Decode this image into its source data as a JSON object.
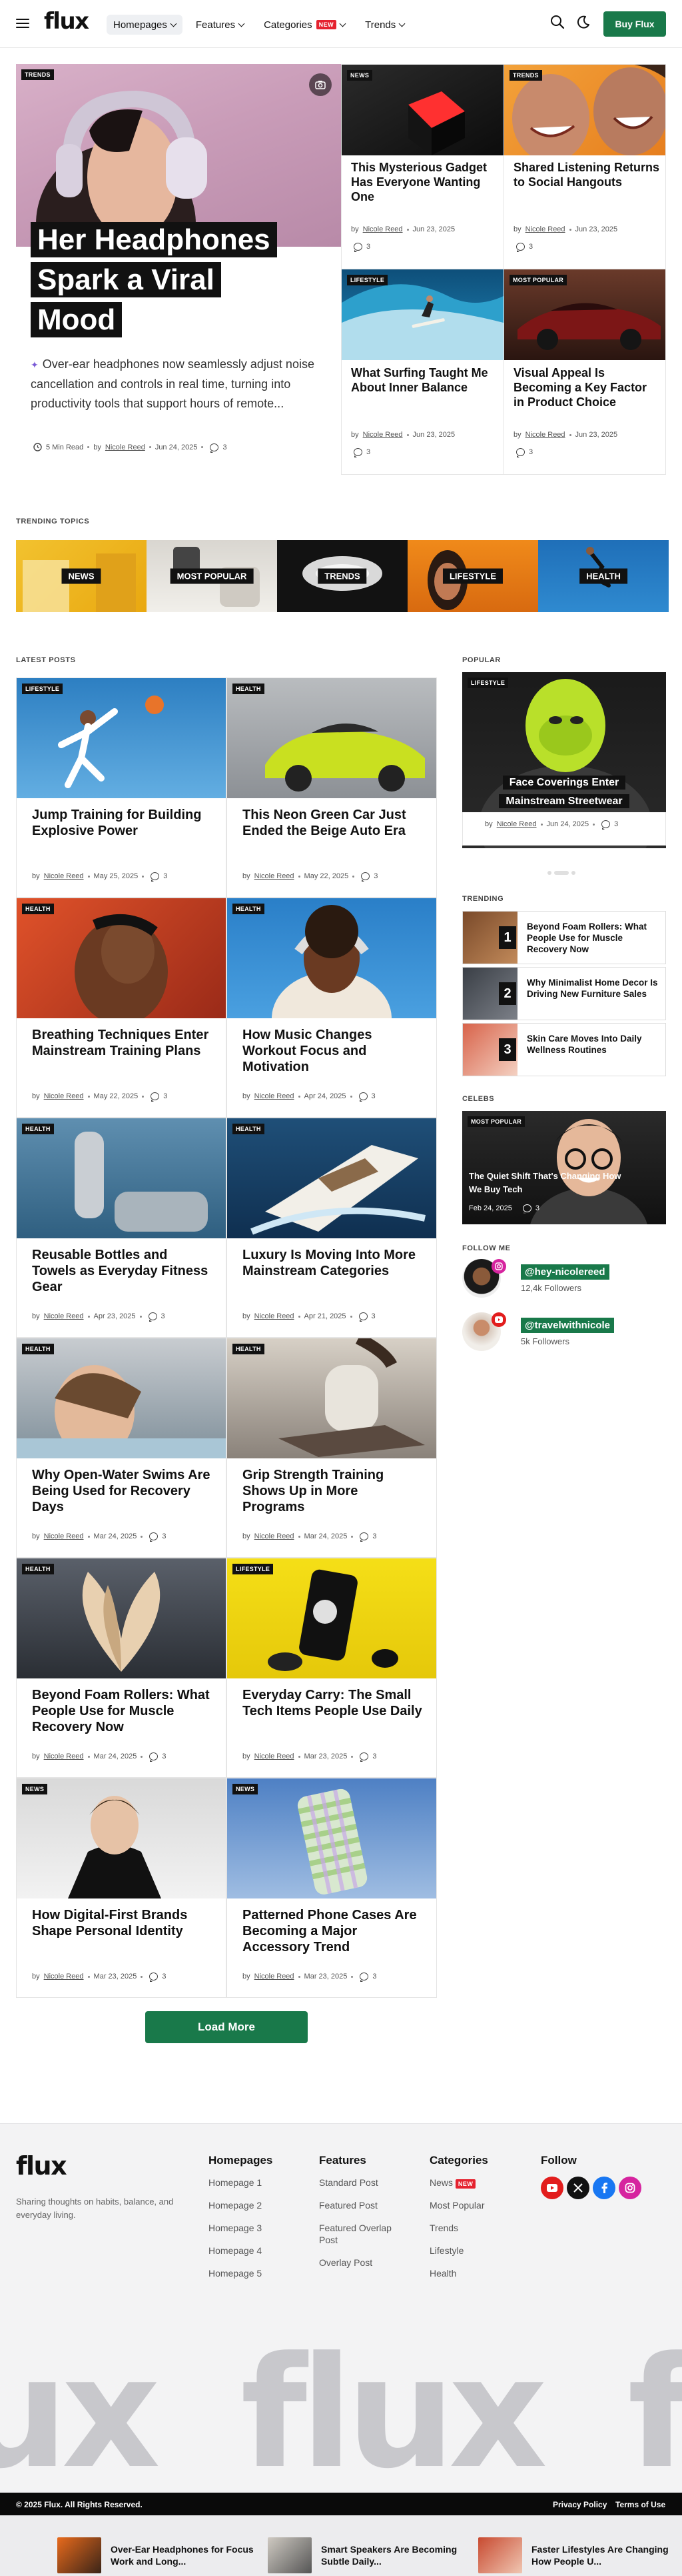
{
  "header": {
    "logo": "flux",
    "nav": [
      {
        "label": "Homepages"
      },
      {
        "label": "Features"
      },
      {
        "label": "Categories",
        "badge": "NEW"
      },
      {
        "label": "Trends"
      }
    ],
    "buy_label": "Buy Flux"
  },
  "hero": {
    "tag": "TRENDS",
    "title_lines": [
      "Her Headphones",
      "Spark a Viral",
      "Mood"
    ],
    "excerpt": "Over-ear headphones now seamlessly adjust noise cancellation and controls in real time, turning into productivity tools that support hours of remote...",
    "read_time": "5 Min Read",
    "by": "by",
    "author": "Nicole Reed",
    "date": "Jun 24, 2025",
    "comments": "3"
  },
  "hero_grid": [
    {
      "tag": "NEWS",
      "title": "This Mysterious Gadget Has Everyone Wanting One",
      "by": "by",
      "author": "Nicole Reed",
      "date": "Jun 23, 2025",
      "comments": "3"
    },
    {
      "tag": "TRENDS",
      "title": "Shared Listening Returns to Social Hangouts",
      "by": "by",
      "author": "Nicole Reed",
      "date": "Jun 23, 2025",
      "comments": "3"
    },
    {
      "tag": "LIFESTYLE",
      "title": "What Surfing Taught Me About Inner Balance",
      "by": "by",
      "author": "Nicole Reed",
      "date": "Jun 23, 2025",
      "comments": "3"
    },
    {
      "tag": "MOST POPULAR",
      "title": "Visual Appeal Is Becoming a Key Factor in Product Choice",
      "by": "by",
      "author": "Nicole Reed",
      "date": "Jun 23, 2025",
      "comments": "3"
    }
  ],
  "trending_topics": {
    "heading": "TRENDING TOPICS",
    "items": [
      "NEWS",
      "MOST POPULAR",
      "TRENDS",
      "LIFESTYLE",
      "HEALTH"
    ]
  },
  "latest": {
    "heading": "LATEST POSTS",
    "posts": [
      {
        "tag": "LIFESTYLE",
        "title": "Jump Training for Building Explosive Power",
        "by": "by",
        "author": "Nicole Reed",
        "date": "May 25, 2025",
        "comments": "3"
      },
      {
        "tag": "HEALTH",
        "title": "This Neon Green Car Just Ended the Beige Auto Era",
        "by": "by",
        "author": "Nicole Reed",
        "date": "May 22, 2025",
        "comments": "3"
      },
      {
        "tag": "HEALTH",
        "title": "Breathing Techniques Enter Mainstream Training Plans",
        "by": "by",
        "author": "Nicole Reed",
        "date": "May 22, 2025",
        "comments": "3"
      },
      {
        "tag": "HEALTH",
        "title": "How Music Changes Workout Focus and Motivation",
        "by": "by",
        "author": "Nicole Reed",
        "date": "Apr 24, 2025",
        "comments": "3"
      },
      {
        "tag": "HEALTH",
        "title": "Reusable Bottles and Towels as Everyday Fitness Gear",
        "by": "by",
        "author": "Nicole Reed",
        "date": "Apr 23, 2025",
        "comments": "3"
      },
      {
        "tag": "HEALTH",
        "title": "Luxury Is Moving Into More Mainstream Categories",
        "by": "by",
        "author": "Nicole Reed",
        "date": "Apr 21, 2025",
        "comments": "3"
      },
      {
        "tag": "HEALTH",
        "title": "Why Open-Water Swims Are Being Used for Recovery Days",
        "by": "by",
        "author": "Nicole Reed",
        "date": "Mar 24, 2025",
        "comments": "3"
      },
      {
        "tag": "HEALTH",
        "title": "Grip Strength Training Shows Up in More Programs",
        "by": "by",
        "author": "Nicole Reed",
        "date": "Mar 24, 2025",
        "comments": "3"
      },
      {
        "tag": "HEALTH",
        "title": "Beyond Foam Rollers: What People Use for Muscle Recovery Now",
        "by": "by",
        "author": "Nicole Reed",
        "date": "Mar 24, 2025",
        "comments": "3"
      },
      {
        "tag": "LIFESTYLE",
        "title": "Everyday Carry: The Small Tech Items People Use Daily",
        "by": "by",
        "author": "Nicole Reed",
        "date": "Mar 23, 2025",
        "comments": "3"
      },
      {
        "tag": "NEWS",
        "title": "How Digital-First Brands Shape Personal Identity",
        "by": "by",
        "author": "Nicole Reed",
        "date": "Mar 23, 2025",
        "comments": "3"
      },
      {
        "tag": "NEWS",
        "title": "Patterned Phone Cases Are Becoming a Major Accessory Trend",
        "by": "by",
        "author": "Nicole Reed",
        "date": "Mar 23, 2025",
        "comments": "3"
      }
    ],
    "load_more": "Load More"
  },
  "sidebar": {
    "popular_heading": "POPULAR",
    "popular": {
      "tag": "LIFESTYLE",
      "title_lines": [
        "Face Coverings Enter",
        "Mainstream Streetwear"
      ],
      "by": "by",
      "author": "Nicole Reed",
      "date": "Jun 24, 2025",
      "comments": "3"
    },
    "trending_heading": "TRENDING",
    "trending": [
      {
        "num": "1",
        "title": "Beyond Foam Rollers: What People Use for Muscle Recovery Now"
      },
      {
        "num": "2",
        "title": "Why Minimalist Home Decor Is Driving New Furniture Sales"
      },
      {
        "num": "3",
        "title": "Skin Care Moves Into Daily Wellness Routines"
      }
    ],
    "celebs_heading": "CELEBS",
    "celeb": {
      "tag": "MOST POPULAR",
      "title_lines": [
        "The Quiet Shift That's Changing How",
        "We Buy Tech"
      ],
      "date": "Feb 24, 2025",
      "comments": "3"
    },
    "follow_heading": "FOLLOW ME",
    "follow": [
      {
        "handle": "@hey-nicolereed",
        "followers": "12,4k Followers"
      },
      {
        "handle": "@travelwithnicole",
        "followers": "5k Followers"
      }
    ]
  },
  "footer": {
    "logo": "flux",
    "tagline": "Sharing thoughts on habits, balance, and everyday living.",
    "columns": [
      {
        "title": "Homepages",
        "links": [
          "Homepage 1",
          "Homepage 2",
          "Homepage 3",
          "Homepage 4",
          "Homepage 5"
        ]
      },
      {
        "title": "Features",
        "links": [
          "Standard Post",
          "Featured Post",
          "Featured Overlap Post",
          "Overlay Post"
        ]
      },
      {
        "title": "Categories",
        "links": [
          "News",
          "Most Popular",
          "Trends",
          "Lifestyle",
          "Health"
        ],
        "badge": "NEW"
      },
      {
        "title": "Follow",
        "links": []
      }
    ],
    "big_word": "flux",
    "copyright": "© 2025 Flux. All Rights Reserved.",
    "legal": [
      "Privacy Policy",
      "Terms of Use"
    ]
  },
  "bottom_bar": [
    {
      "title": "Over-Ear Headphones for Focus Work and Long..."
    },
    {
      "title": "Smart Speakers Are Becoming Subtle Daily..."
    },
    {
      "title": "Faster Lifestyles Are Changing How People U..."
    }
  ],
  "colors": {
    "accent": "#19794a",
    "badge": "#e5222f",
    "text": "#111111"
  }
}
